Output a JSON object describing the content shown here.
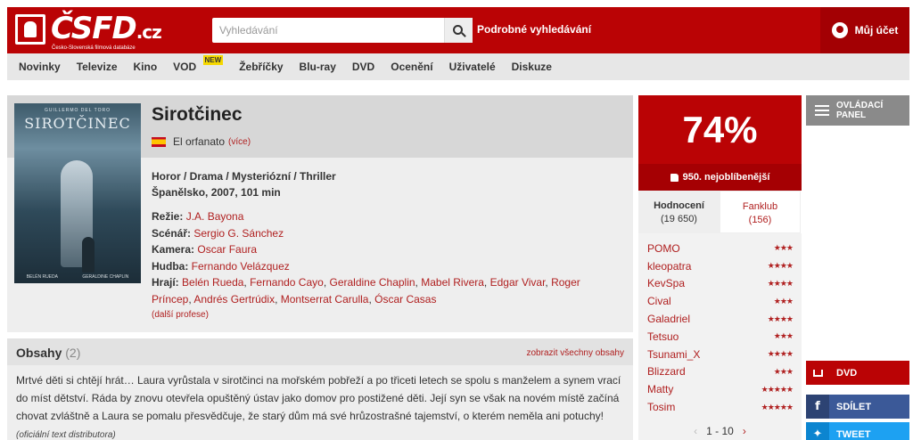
{
  "header": {
    "logo_brand": "ČSFD",
    "logo_tld": ".cz",
    "logo_tagline": "Česko-Slovenská filmová databáze",
    "search_placeholder": "Vyhledávání",
    "advanced_search": "Podrobné vyhledávání",
    "account": "Můj účet"
  },
  "nav": {
    "items": [
      "Novinky",
      "Televize",
      "Kino",
      "VOD",
      "Žebříčky",
      "Blu-ray",
      "DVD",
      "Ocenění",
      "Uživatelé",
      "Diskuze"
    ],
    "vod_badge": "NEW"
  },
  "film": {
    "title": "Sirotčinec",
    "original_title": "El orfanato",
    "original_more": "(více)",
    "genres": "Horor / Drama / Mysteriózní / Thriller",
    "origin": "Španělsko, 2007, 101 min",
    "crew": [
      {
        "label": "Režie:",
        "names": [
          "J.A. Bayona"
        ]
      },
      {
        "label": "Scénář:",
        "names": [
          "Sergio G. Sánchez"
        ]
      },
      {
        "label": "Kamera:",
        "names": [
          "Oscar Faura"
        ]
      },
      {
        "label": "Hudba:",
        "names": [
          "Fernando Velázquez"
        ]
      },
      {
        "label": "Hrají:",
        "names": [
          "Belén Rueda",
          "Fernando Cayo",
          "Geraldine Chaplin",
          "Mabel Rivera",
          "Edgar Vivar",
          "Roger Príncep",
          "Andrés Gertrúdix",
          "Montserrat Carulla",
          "Óscar Casas"
        ]
      }
    ],
    "more_professions": "(další profese)",
    "poster": {
      "top_text": "GUILLERMO DEL TORO",
      "title": "SIROTČINEC",
      "name_left": "BELÉN RUEDA",
      "name_right": "GERALDINE CHAPLIN"
    }
  },
  "plot": {
    "title": "Obsahy",
    "count": "(2)",
    "show_all": "zobrazit všechny obsahy",
    "text": "Mrtvé děti si chtějí hrát… Laura vyrůstala v sirotčinci na mořském pobřeží a po třiceti letech se spolu s manželem a synem vrací do míst dětství. Ráda by znovu otevřela opuštěný ústav jako domov pro postižené děti. Její syn se však na novém místě začíná chovat zvláštně a Laura se pomalu přesvědčuje, že starý dům má své hrůzostrašné tajemství, o kterém neměla ani potuchy!",
    "source": "(oficiální text distributora)"
  },
  "rating": {
    "percent": "74%",
    "rank": "950. nejoblíbenější",
    "tabs": [
      {
        "label": "Hodnocení",
        "count": "(19 650)"
      },
      {
        "label": "Fanklub",
        "count": "(156)"
      }
    ],
    "users": [
      {
        "name": "POMO",
        "stars": "★★★"
      },
      {
        "name": "kleopatra",
        "stars": "★★★★"
      },
      {
        "name": "KevSpa",
        "stars": "★★★★"
      },
      {
        "name": "Cival",
        "stars": "★★★"
      },
      {
        "name": "Galadriel",
        "stars": "★★★★"
      },
      {
        "name": "Tetsuo",
        "stars": "★★★"
      },
      {
        "name": "Tsunami_X",
        "stars": "★★★★"
      },
      {
        "name": "Blizzard",
        "stars": "★★★"
      },
      {
        "name": "Matty",
        "stars": "★★★★★"
      },
      {
        "name": "Tosim",
        "stars": "★★★★★"
      }
    ],
    "pager": "1 - 10",
    "pager_prev": "‹",
    "pager_next": "›"
  },
  "side": {
    "panel": "OVLÁDACÍ PANEL",
    "dvd": "DVD",
    "share": "SDÍLET",
    "tweet": "TWEET",
    "share_icon": "f",
    "tweet_icon": "🐦"
  },
  "colors": {
    "brand_red": "#ba0305",
    "link_red": "#b02020",
    "facebook": "#3b5998",
    "twitter": "#1da1f2"
  }
}
